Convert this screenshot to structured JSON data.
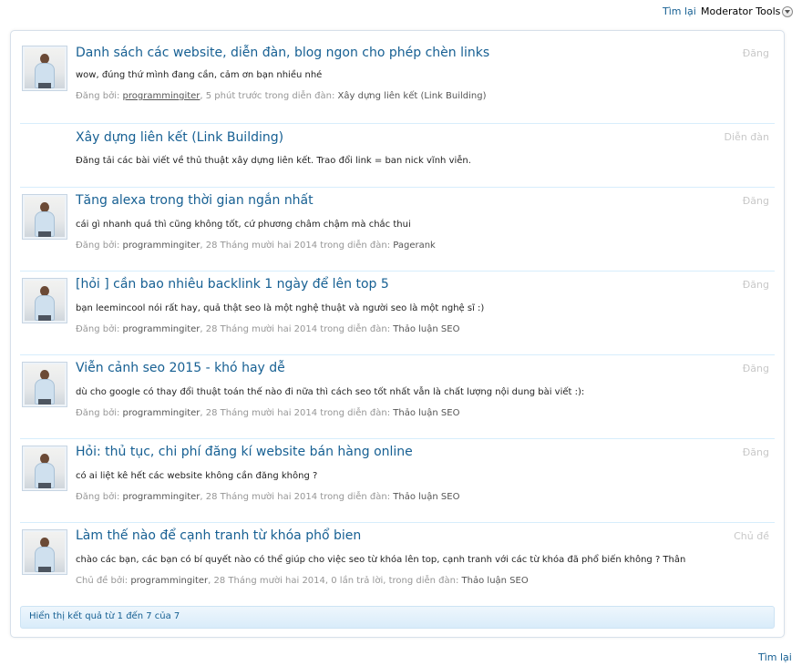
{
  "top": {
    "back_label": "Tìm lại",
    "moderator_tools_label": "Moderator Tools"
  },
  "results": [
    {
      "title": "Danh sách các website, diễn đàn, blog ngon cho phép chèn links",
      "type": "Đăng",
      "snippet": "wow, đúng thứ mình đang cần, cảm ơn bạn nhiều nhé",
      "meta_prefix": "Đăng bởi: ",
      "author": "programmingiter",
      "meta_middle": ", 5 phút trước trong diễn đàn: ",
      "forum": "Xây dựng liên kết (Link Building)"
    },
    {
      "title": "Xây dựng liên kết (Link Building)",
      "type": "Diễn đàn",
      "snippet": "Đăng tải các bài viết về thủ thuật xây dựng liên kết. Trao đổi link = ban nick vĩnh viễn."
    },
    {
      "title": "Tăng alexa trong thời gian ngắn nhất",
      "type": "Đăng",
      "snippet": "cái gì nhanh quá thì cũng không tốt, cứ phương châm chậm mà chắc thui",
      "meta_prefix": "Đăng bởi: ",
      "author": "programmingiter",
      "meta_middle": ", 28 Tháng mười hai 2014 trong diễn đàn: ",
      "forum": "Pagerank"
    },
    {
      "title": "[hỏi ] cần bao nhiêu backlink 1 ngày để lên top 5",
      "type": "Đăng",
      "snippet": "bạn leemincool nói rất hay, quả thật seo là một nghệ thuật và người seo là một nghệ sĩ :)",
      "meta_prefix": "Đăng bởi: ",
      "author": "programmingiter",
      "meta_middle": ", 28 Tháng mười hai 2014 trong diễn đàn: ",
      "forum": "Thảo luận SEO"
    },
    {
      "title": "Viễn cảnh seo 2015 - khó hay dễ",
      "type": "Đăng",
      "snippet": "dù cho google có thay đổi thuật toán thế nào đi nữa thì cách seo tốt nhất vẫn là chất lượng nội dung bài viết :):",
      "meta_prefix": "Đăng bởi: ",
      "author": "programmingiter",
      "meta_middle": ", 28 Tháng mười hai 2014 trong diễn đàn: ",
      "forum": "Thảo luận SEO"
    },
    {
      "title": "Hỏi: thủ tục, chi phí đăng kí website bán hàng online",
      "type": "Đăng",
      "snippet": "có ai liệt kê hết các website không cần đăng không ?",
      "meta_prefix": "Đăng bởi: ",
      "author": "programmingiter",
      "meta_middle": ", 28 Tháng mười hai 2014 trong diễn đàn: ",
      "forum": "Thảo luận SEO"
    },
    {
      "title": "Làm thế nào để cạnh tranh từ khóa phổ bien",
      "type": "Chủ đề",
      "snippet": "chào các bạn, các bạn có bí quyết nào có thể giúp cho việc seo từ khóa lên top, cạnh tranh với các từ khóa đã phổ biến không ? Thân",
      "meta_prefix": "Chủ đề bởi: ",
      "author": "programmingiter",
      "meta_middle": ", 28 Tháng mười hai 2014, 0 lần trả lời, trong diễn đàn: ",
      "forum": "Thảo luận SEO"
    }
  ],
  "footer": {
    "summary": "Hiển thị kết quả từ 1 đến 7 của 7"
  },
  "bottom": {
    "back_label": "Tìm lại"
  }
}
